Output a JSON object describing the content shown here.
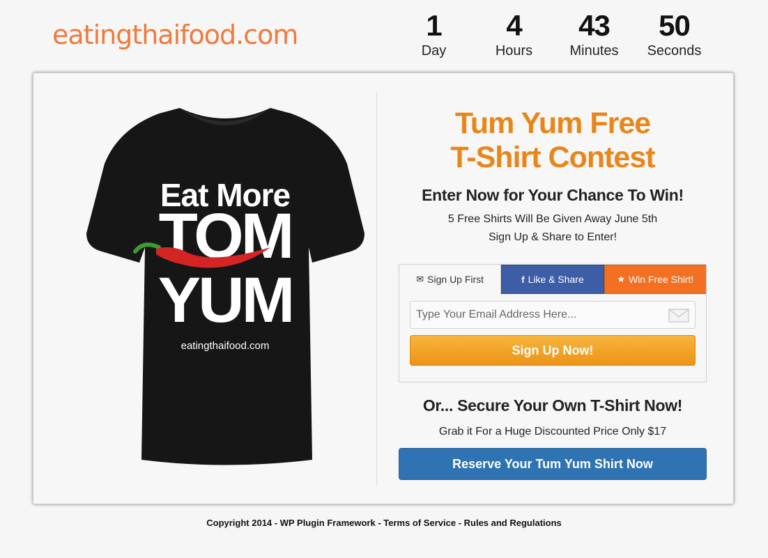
{
  "header": {
    "logo_text": "eatingthaifood.com",
    "countdown": [
      {
        "value": "1",
        "label": "Day"
      },
      {
        "value": "4",
        "label": "Hours"
      },
      {
        "value": "43",
        "label": "Minutes"
      },
      {
        "value": "50",
        "label": "Seconds"
      }
    ]
  },
  "shirt": {
    "line1": "Eat More",
    "line2": "TOM",
    "line3": "YUM",
    "site": "eatingthaifood.com"
  },
  "contest": {
    "title_line1": "Tum Yum Free",
    "title_line2": "T-Shirt Contest",
    "subtitle": "Enter Now for Your Chance To Win!",
    "line1": "5 Free Shirts Will Be Given Away June 5th",
    "line2": "Sign Up & Share to Enter!"
  },
  "tabs": [
    {
      "label": "Sign Up First",
      "icon": "envelope-icon"
    },
    {
      "label": "Like & Share",
      "icon": "facebook-icon"
    },
    {
      "label": "Win Free Shirt!",
      "icon": "star-icon"
    }
  ],
  "form": {
    "email_placeholder": "Type Your Email Address Here...",
    "signup_label": "Sign Up Now!"
  },
  "secure": {
    "title": "Or... Secure Your Own T-Shirt Now!",
    "subtitle": "Grab it For a Huge Discounted Price Only $17",
    "button_label": "Reserve Your Tum Yum Shirt Now"
  },
  "footer": {
    "text": "Copyright 2014 - WP Plugin Framework - Terms of Service - Rules and Regulations"
  },
  "colors": {
    "brand_orange": "#f07a3c",
    "title_orange": "#e8861a",
    "facebook_blue": "#3d5ea7",
    "cta_blue": "#2f73b3"
  }
}
